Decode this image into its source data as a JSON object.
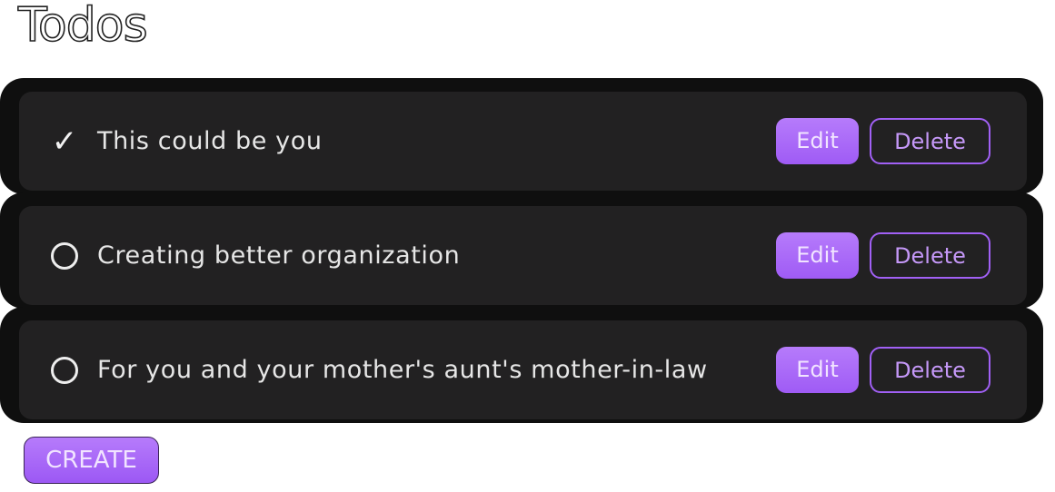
{
  "page": {
    "title": "Todos"
  },
  "todos": [
    {
      "text": "This could be you",
      "completed": true,
      "edit_label": "Edit",
      "delete_label": "Delete"
    },
    {
      "text": "Creating better organization",
      "completed": false,
      "edit_label": "Edit",
      "delete_label": "Delete"
    },
    {
      "text": "For you and your mother's aunt's mother-in-law",
      "completed": false,
      "edit_label": "Edit",
      "delete_label": "Delete"
    }
  ],
  "actions": {
    "create_label": "CREATE"
  },
  "icons": {
    "completed": "checkmark-icon",
    "incomplete": "circle-icon",
    "checkmark_glyph": "✓"
  },
  "colors": {
    "accent": "#a160f5",
    "accent_light": "#b67bfb",
    "card_outer": "#0f0f0f",
    "card_inner": "#222122",
    "text": "#e6e6e6"
  }
}
